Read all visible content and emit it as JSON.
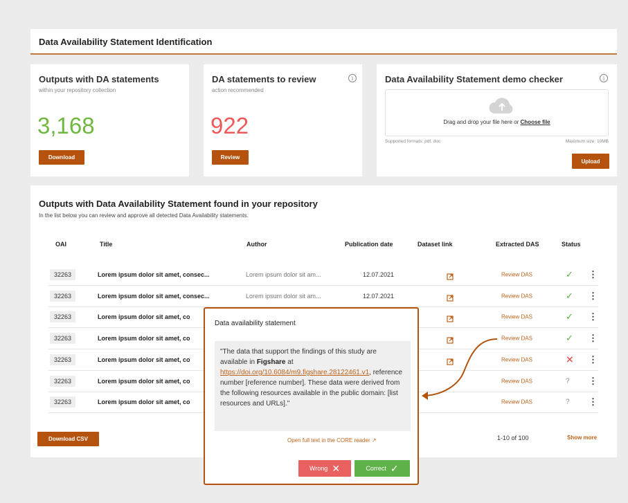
{
  "header": {
    "title": "Data Availability Statement Identification"
  },
  "cards": {
    "outputs": {
      "title": "Outputs with DA statements",
      "subtitle": "within your repository collection",
      "value": "3,168",
      "value_color": "#6fb83f",
      "button": "Download"
    },
    "review": {
      "title": "DA statements to review",
      "subtitle": "action recommended",
      "value": "922",
      "value_color": "#ee5a5a",
      "button": "Review",
      "info_icon": "info-icon"
    },
    "checker": {
      "title": "Data Availability Statement demo checker",
      "drop_text": "Drag and drop your file here or ",
      "choose_file": "Choose file",
      "formats": "Supported formats: pdf, doc",
      "max_size": "Maximum  size: 10MB",
      "button": "Upload",
      "info_icon": "info-icon",
      "upload_icon": "cloud-upload-icon"
    }
  },
  "main": {
    "title": "Outputs with Data Availability Statement found in your repository",
    "subtitle": "In the list below you can review and approve all detected Data Availability statements.",
    "columns": [
      "OAI",
      "Title",
      "Author",
      "Publication date",
      "Dataset link",
      "Extracted DAS",
      "Status"
    ],
    "rows": [
      {
        "oai": "32263",
        "title": "Lorem ipsum dolor sit amet, consec...",
        "author": "Lorem ipsum dolor sit am...",
        "date": "12.07.2021",
        "link": true,
        "das": "Review DAS",
        "status": "✓",
        "status_type": "ok"
      },
      {
        "oai": "32263",
        "title": "Lorem ipsum dolor sit amet, consec...",
        "author": "Lorem ipsum dolor sit am...",
        "date": "12.07.2021",
        "link": true,
        "das": "Review DAS",
        "status": "✓",
        "status_type": "ok"
      },
      {
        "oai": "32263",
        "title": "Lorem ipsum dolor sit amet, co",
        "author": "",
        "date": "",
        "link": true,
        "das": "Review DAS",
        "status": "✓",
        "status_type": "ok"
      },
      {
        "oai": "32263",
        "title": "Lorem ipsum dolor sit amet, co",
        "author": "",
        "date": "",
        "link": true,
        "das": "Review DAS",
        "status": "✓",
        "status_type": "ok"
      },
      {
        "oai": "32263",
        "title": "Lorem ipsum dolor sit amet, co",
        "author": "",
        "date": "",
        "link": true,
        "das": "Review DAS",
        "status": "✕",
        "status_type": "bad"
      },
      {
        "oai": "32263",
        "title": "Lorem ipsum dolor sit amet, co",
        "author": "",
        "date": "",
        "link": false,
        "das": "Review DAS",
        "status": "?",
        "status_type": "unk"
      },
      {
        "oai": "32263",
        "title": "Lorem ipsum dolor sit amet, co",
        "author": "",
        "date": "",
        "link": false,
        "das": "Review DAS",
        "status": "?",
        "status_type": "unk"
      }
    ],
    "download_csv": "Download CSV",
    "pagination": "1-10  of  100",
    "show_more": "Show more"
  },
  "popup": {
    "title": "Data availability statement",
    "quote_pre": "\"The data that support the findings of this study are available in ",
    "quote_bold": "Figshare",
    "quote_mid": " at ",
    "quote_link": "https://doi.org/10.6084/m9.figshare.28122461.v1",
    "quote_post": ", reference number [reference number]. These data were derived from the following resources available in the public domain: [list resources and URLs].\"",
    "open_full": "Open full text in the CORE reader",
    "wrong": "Wrong",
    "correct": "Correct"
  }
}
